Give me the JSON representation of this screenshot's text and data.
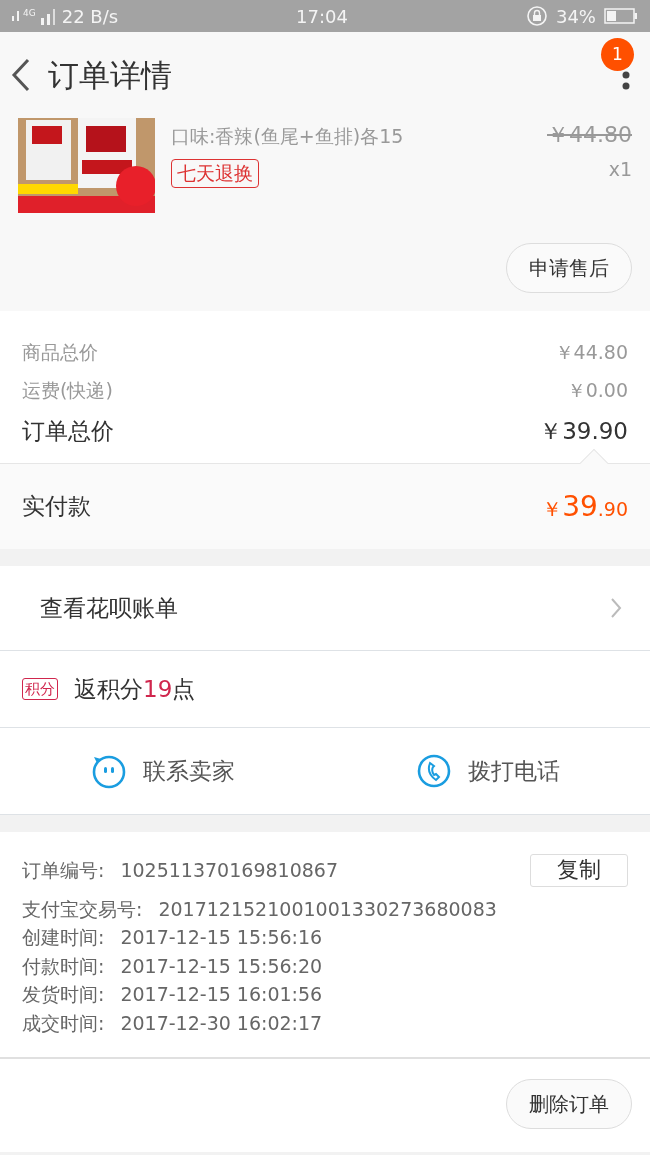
{
  "status_bar": {
    "network": "4G",
    "speed": "22 B/s",
    "time": "17:04",
    "battery": "34%"
  },
  "header": {
    "title": "订单详情",
    "badge": "1"
  },
  "product": {
    "spec": "口味:香辣(鱼尾+鱼排)各15",
    "tag": "七天退换",
    "original_price": "￥44.80",
    "quantity": "x1",
    "action": "申请售后"
  },
  "summary": {
    "rows": [
      {
        "label": "商品总价",
        "value": "￥44.80",
        "kind": "minor"
      },
      {
        "label": "运费(快递)",
        "value": "￥0.00",
        "kind": "minor"
      },
      {
        "label": "订单总价",
        "value": "￥39.90",
        "kind": "major"
      }
    ],
    "paid_label": "实付款",
    "paid_currency": "￥",
    "paid_integer": "39",
    "paid_decimal": ".90"
  },
  "huabei": {
    "label": "查看花呗账单"
  },
  "points": {
    "tag": "积分",
    "before": "返积分",
    "count": "19",
    "after": "点"
  },
  "contact": [
    {
      "label": "联系卖家",
      "kind": "chat"
    },
    {
      "label": "拨打电话",
      "kind": "phone"
    }
  ],
  "order_info": {
    "copy_button": "复制",
    "rows": [
      {
        "label": "订单编号:",
        "value": "102511370169810867"
      },
      {
        "label": "支付宝交易号:",
        "value": "2017121521001001330273680083"
      },
      {
        "label": "创建时间:",
        "value": "2017-12-15 15:56:16"
      },
      {
        "label": "付款时间:",
        "value": "2017-12-15 15:56:20"
      },
      {
        "label": "发货时间:",
        "value": "2017-12-15 16:01:56"
      },
      {
        "label": "成交时间:",
        "value": "2017-12-30 16:02:17"
      }
    ]
  },
  "footer": {
    "delete_button": "删除订单"
  }
}
